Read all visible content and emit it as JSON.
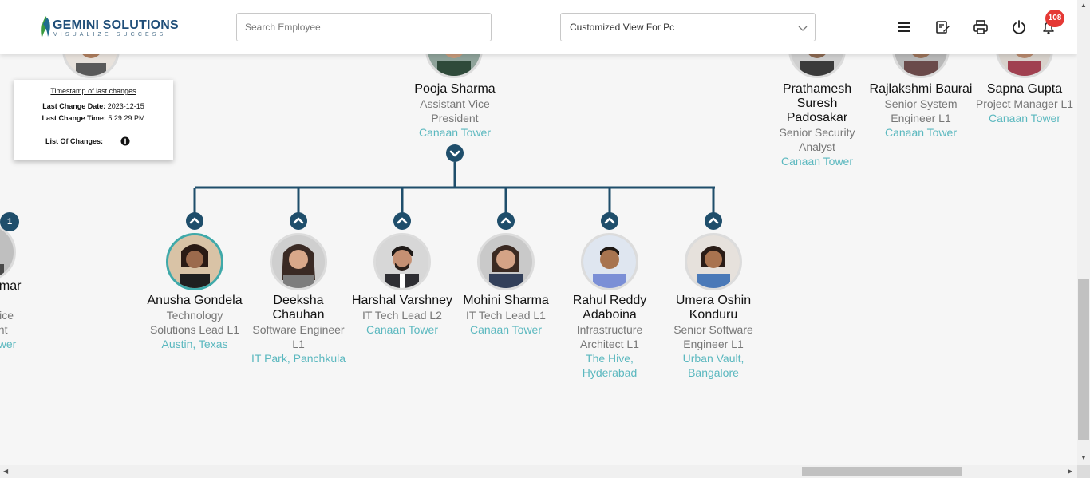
{
  "header": {
    "logo_name": "GEMINI SOLUTIONS",
    "logo_tagline": "VISUALIZE SUCCESS",
    "search_placeholder": "Search Employee",
    "view_selected": "Customized View For Pc",
    "notification_count": "108",
    "icons": [
      "menu-icon",
      "edit-notes-icon",
      "print-icon",
      "power-icon",
      "bell-icon"
    ]
  },
  "timestamp_panel": {
    "title": "Timestamp of last changes",
    "date_label": "Last Change Date:",
    "date_value": "2023-12-15",
    "time_label": "Last Change Time:",
    "time_value": "5:29:29 PM",
    "changes_label": "List Of Changes:"
  },
  "manager": {
    "name": "Pooja Sharma",
    "role": "Assistant Vice President",
    "location": "Canaan Tower"
  },
  "peers_right": [
    {
      "name": "Prathamesh Suresh Padosakar",
      "role": "Senior Security Analyst",
      "location": "Canaan Tower"
    },
    {
      "name": "Rajlakshmi Baurai",
      "role": "Senior System Engineer L1",
      "location": "Canaan Tower"
    },
    {
      "name": "Sapna Gupta",
      "role": "Project Manager L1",
      "location": "Canaan Tower"
    }
  ],
  "partial_left": {
    "badge": "1",
    "name_fragment": "umar",
    "line2": "ıt",
    "line3": "Vice",
    "line4": "ent",
    "line5": "ower"
  },
  "reports": [
    {
      "name": "Anusha Gondela",
      "role": "Technology Solutions Lead L1",
      "location": "Austin, Texas"
    },
    {
      "name": "Deeksha Chauhan",
      "role": "Software Engineer L1",
      "location": "IT Park, Panchkula"
    },
    {
      "name": "Harshal Varshney",
      "role": "IT Tech Lead L2",
      "location": "Canaan Tower"
    },
    {
      "name": "Mohini Sharma",
      "role": "IT Tech Lead L1",
      "location": "Canaan Tower"
    },
    {
      "name": "Rahul Reddy Adaboina",
      "role": "Infrastructure Architect L1",
      "location": "The Hive, Hyderabad"
    },
    {
      "name": "Umera Oshin Konduru",
      "role": "Senior Software Engineer L1",
      "location": "Urban Vault, Bangalore"
    }
  ],
  "colors": {
    "connector": "#1f4e6b",
    "location": "#5bb8bf",
    "badge": "#e53935",
    "selected_ring": "#3fa9a9"
  }
}
